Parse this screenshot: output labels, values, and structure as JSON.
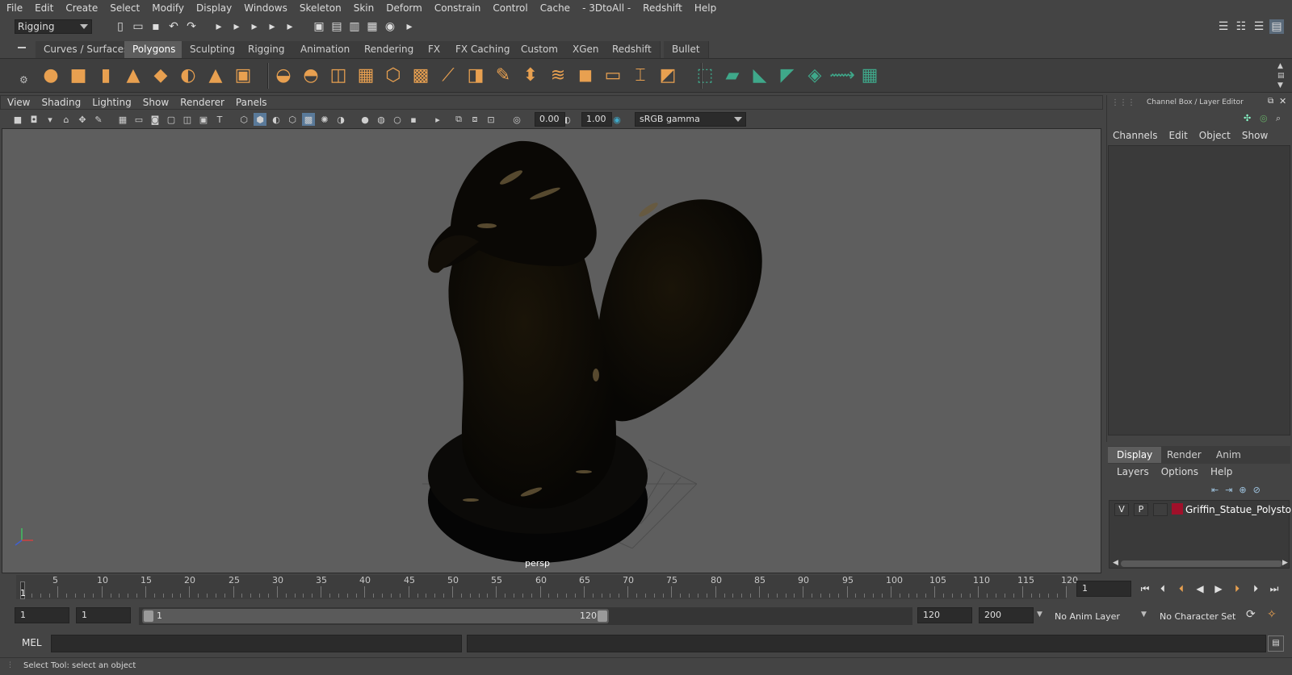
{
  "menus": [
    "File",
    "Edit",
    "Create",
    "Select",
    "Modify",
    "Display",
    "Windows",
    "Skeleton",
    "Skin",
    "Deform",
    "Constrain",
    "Control",
    "Cache",
    "- 3DtoAll -",
    "Redshift",
    "Help"
  ],
  "status_line": {
    "menuset": "Rigging"
  },
  "shelf": {
    "tabs": [
      "Curves / Surfaces",
      "Polygons",
      "Sculpting",
      "Rigging",
      "Animation",
      "Rendering",
      "FX",
      "FX Caching",
      "Custom",
      "XGen",
      "Redshift",
      "Bullet"
    ],
    "active_tab": "Polygons"
  },
  "viewport": {
    "menus": [
      "View",
      "Shading",
      "Lighting",
      "Show",
      "Renderer",
      "Panels"
    ],
    "exposure": "0.00",
    "gamma": "1.00",
    "color_space": "sRGB gamma",
    "camera_label": "persp"
  },
  "channel_box": {
    "title": "Channel Box / Layer Editor",
    "menus": [
      "Channels",
      "Edit",
      "Object",
      "Show"
    ]
  },
  "layer_editor": {
    "tabs": [
      "Display",
      "Render",
      "Anim"
    ],
    "active_tab": "Display",
    "menus": [
      "Layers",
      "Options",
      "Help"
    ],
    "layers": [
      {
        "visible": "V",
        "playback": "P",
        "name": "Griffin_Statue_Polystone",
        "color": "#a0102a"
      }
    ]
  },
  "time_slider": {
    "ticks": [
      "5",
      "10",
      "15",
      "20",
      "25",
      "30",
      "35",
      "40",
      "45",
      "50",
      "55",
      "60",
      "65",
      "70",
      "75",
      "80",
      "85",
      "90",
      "95",
      "100",
      "105",
      "110",
      "115",
      "120"
    ],
    "current_frame_label": "1",
    "current_frame": "1"
  },
  "range": {
    "start": "1",
    "playback_start": "1",
    "range_start_label": "1",
    "range_end_label": "120",
    "playback_end": "120",
    "end": "200",
    "anim_layer": "No Anim Layer",
    "character_set": "No Character Set"
  },
  "command_line": {
    "label": "MEL"
  },
  "help_line": {
    "text": "Select Tool: select an object"
  },
  "colors": {
    "shelf_icon": "#e8a050",
    "accent_green": "#3fa88a",
    "viewport_bg": "#5e5e5e",
    "layer_red": "#a0102a"
  }
}
